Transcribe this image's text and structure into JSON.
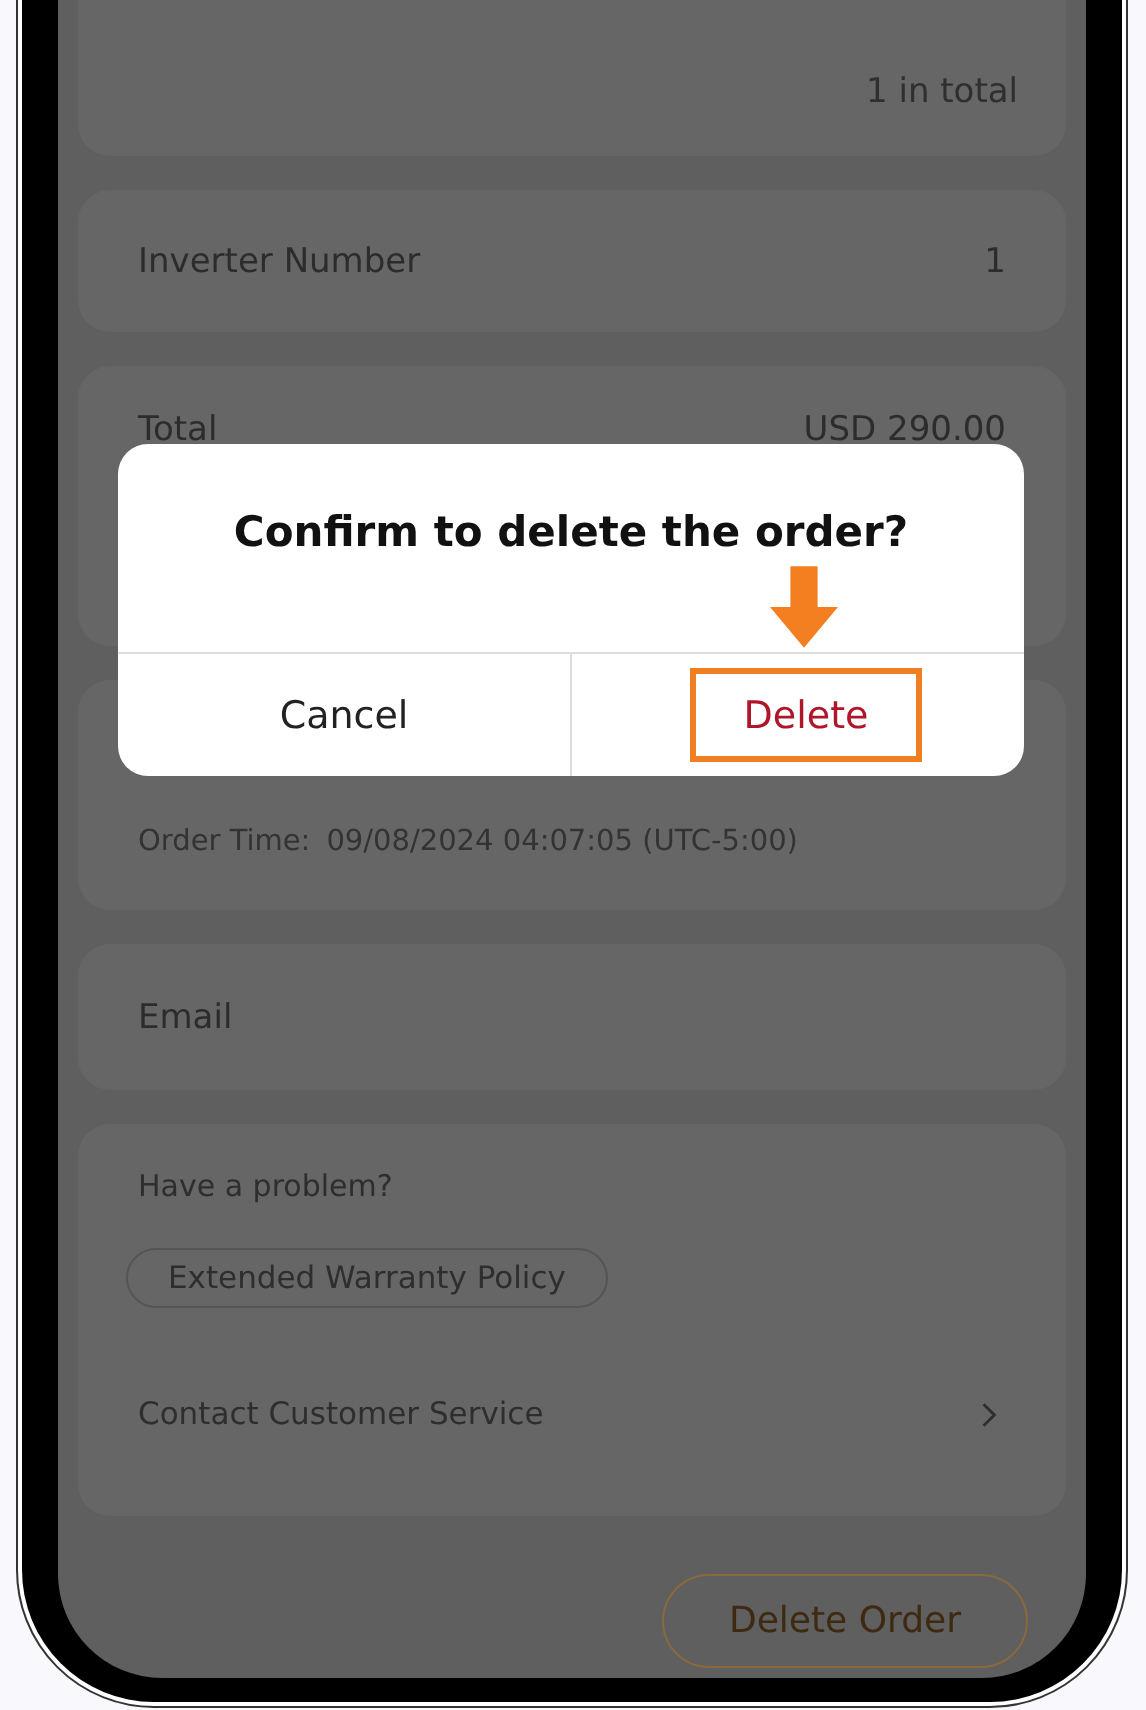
{
  "summary": {
    "count": "1 in total"
  },
  "inverter": {
    "label": "Inverter Number",
    "value": "1"
  },
  "total": {
    "label": "Total",
    "value": "USD 290.00"
  },
  "order_time": {
    "label": "Order Time:",
    "value": "09/08/2024 04:07:05 (UTC-5:00)"
  },
  "email": {
    "label": "Email"
  },
  "help": {
    "title": "Have a problem?",
    "policy_button": "Extended Warranty Policy",
    "contact": "Contact Customer Service"
  },
  "delete_order_button": "Delete Order",
  "dialog": {
    "title": "Confirm to delete the order?",
    "buttons": [
      {
        "label": "Cancel",
        "kind": "cancel",
        "highlighted": false
      },
      {
        "label": "Delete",
        "kind": "destructive",
        "highlighted": true
      }
    ]
  }
}
